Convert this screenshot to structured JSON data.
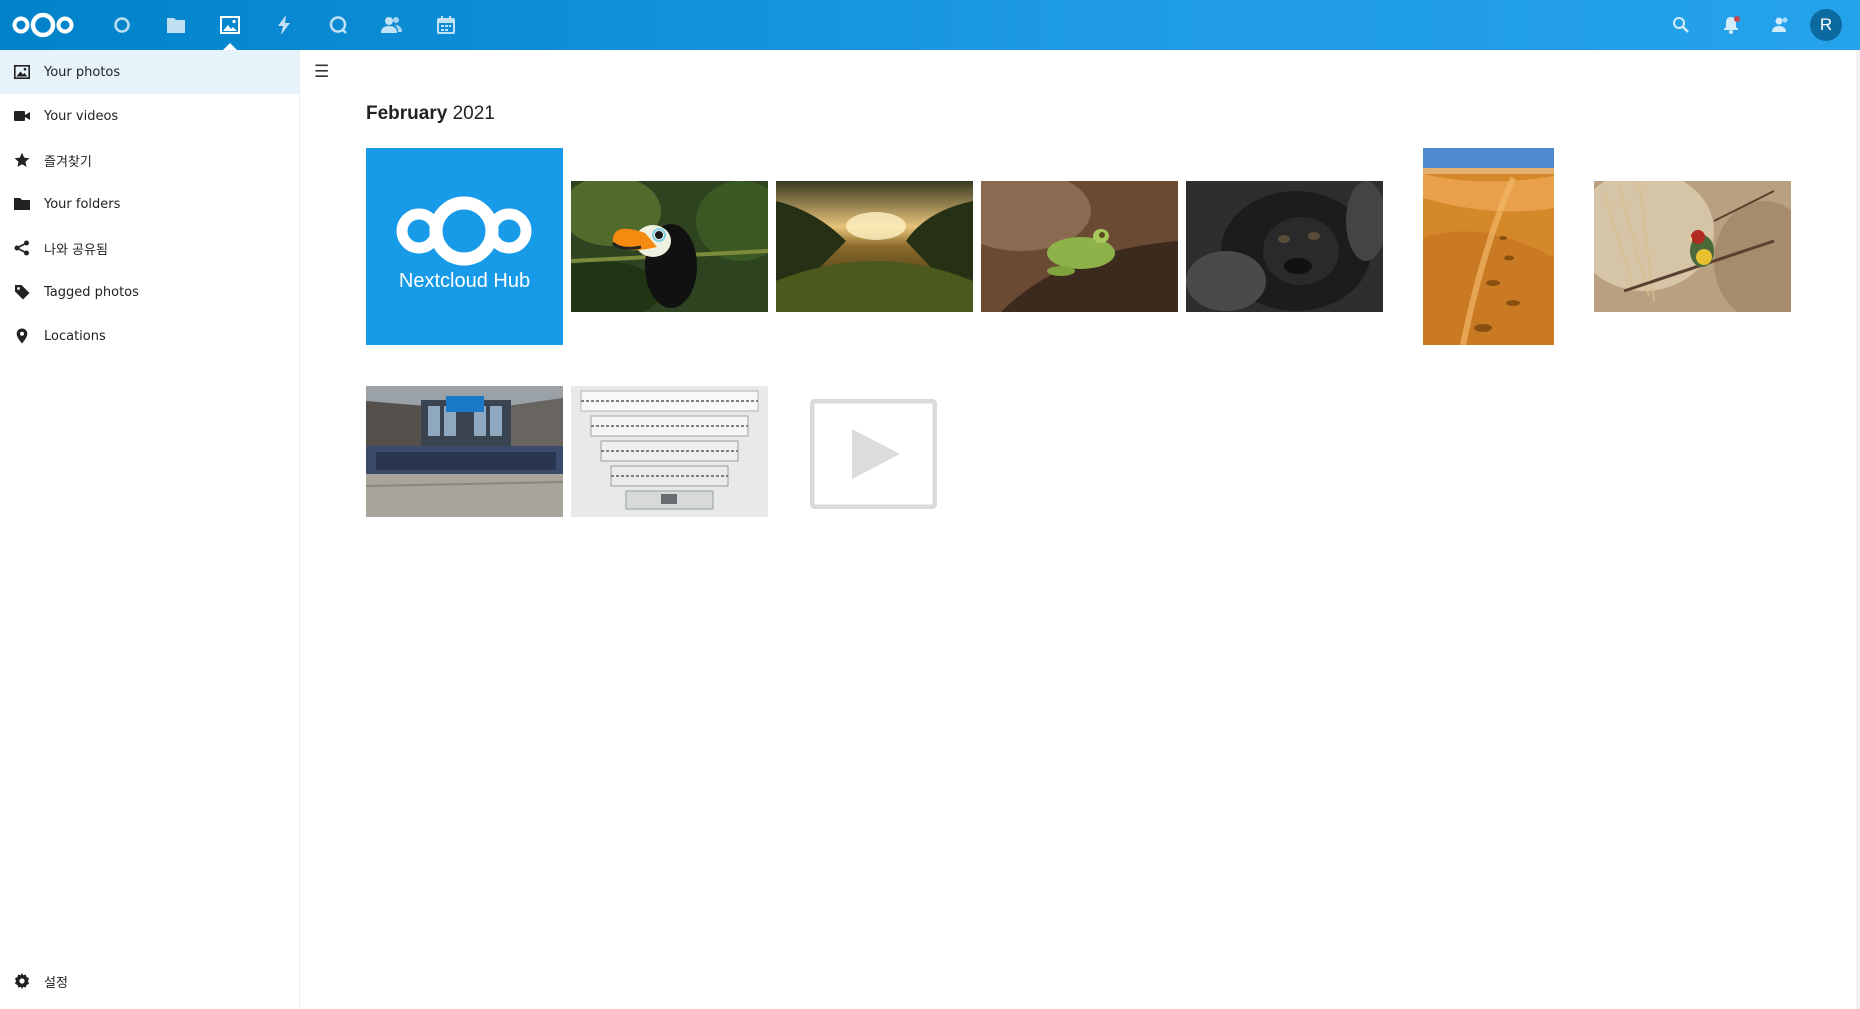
{
  "header": {
    "apps": [
      {
        "name": "dashboard-icon",
        "label": "Dashboard"
      },
      {
        "name": "folder-icon",
        "label": "Files"
      },
      {
        "name": "photos-icon",
        "label": "Photos",
        "active": true
      },
      {
        "name": "activity-icon",
        "label": "Activity"
      },
      {
        "name": "talk-icon",
        "label": "Talk"
      },
      {
        "name": "contacts-icon",
        "label": "Contacts"
      },
      {
        "name": "calendar-icon",
        "label": "Calendar"
      }
    ],
    "avatar_initial": "R",
    "accent": "#0082c9"
  },
  "sidebar": {
    "items": [
      {
        "label": "Your photos",
        "icon": "image-icon",
        "active": true
      },
      {
        "label": "Your videos",
        "icon": "video-icon"
      },
      {
        "label": "즐겨찾기",
        "icon": "star-icon"
      },
      {
        "label": "Your folders",
        "icon": "folder-icon"
      },
      {
        "label": "나와 공유됨",
        "icon": "share-icon"
      },
      {
        "label": "Tagged photos",
        "icon": "tag-icon"
      },
      {
        "label": "Locations",
        "icon": "location-pin-icon"
      }
    ],
    "settings_label": "설정"
  },
  "main": {
    "month": "February",
    "year": "2021",
    "photos": [
      {
        "name": "nextcloud-hub-tile",
        "caption": "Nextcloud Hub"
      },
      {
        "name": "toucan-photo"
      },
      {
        "name": "vineyard-sunset-photo"
      },
      {
        "name": "frog-photo"
      },
      {
        "name": "gorilla-photo"
      },
      {
        "name": "desert-photo"
      },
      {
        "name": "bird-photo"
      },
      {
        "name": "team-photo"
      },
      {
        "name": "library-photo"
      },
      {
        "name": "video-placeholder"
      }
    ]
  }
}
